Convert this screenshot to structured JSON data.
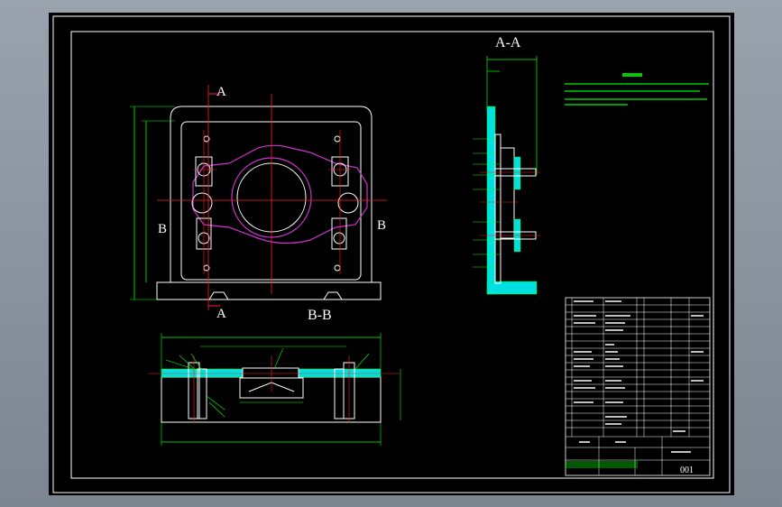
{
  "views": {
    "section_aa": "A-A",
    "section_bb": "B-B",
    "cut_a_top": "A",
    "cut_a_bottom": "A",
    "cut_b_left": "B",
    "cut_b_right": "B"
  },
  "title_block": {
    "drawing_number": "001"
  },
  "colors": {
    "background": "#000000",
    "outline": "#ffffff",
    "centerline": "#ff2020",
    "part": "#cc33cc",
    "dimension": "#00ff00",
    "section_fill": "#00e0e0",
    "frame": "#ffffff"
  }
}
